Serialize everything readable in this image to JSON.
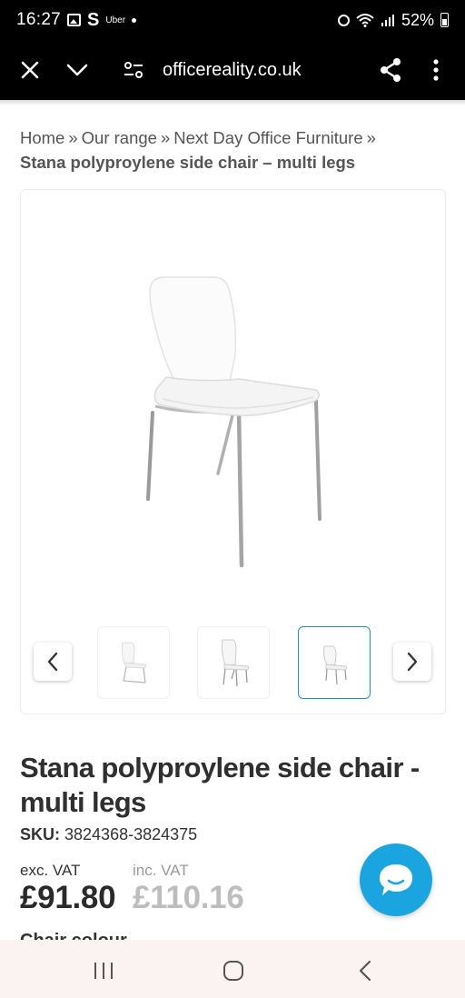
{
  "status_bar": {
    "time": "16:27",
    "s_icon": "S",
    "uber_label": "Uber",
    "battery": "52%",
    "icons": [
      "image-icon",
      "alarm-icon",
      "wifi-icon",
      "signal-icon",
      "battery-icon"
    ]
  },
  "browser": {
    "url": "officereality.co.uk",
    "icons": [
      "close-icon",
      "chevron-down-icon",
      "tune-icon",
      "share-icon",
      "more-icon"
    ]
  },
  "breadcrumb": {
    "items": [
      "Home",
      "Our range",
      "Next Day Office Furniture"
    ],
    "separator": "»",
    "current": "Stana polyproylene side chair – multi legs"
  },
  "gallery": {
    "thumbnail_count": 3,
    "selected_thumbnail": 3
  },
  "product": {
    "title": "Stana polyproylene side chair - multi legs",
    "sku_label": "SKU:",
    "sku_value": "3824368-3824375",
    "exc_vat_label": "exc. VAT",
    "exc_vat_price": "£91.80",
    "inc_vat_label": "inc. VAT",
    "inc_vat_price": "£110.16",
    "cut_off_text": "Chair colour"
  },
  "colors": {
    "accent": "#1a8fd8",
    "chat_button": "#1ba5e0",
    "bar_background": "#000000",
    "nav_background": "#fbf3f1"
  }
}
